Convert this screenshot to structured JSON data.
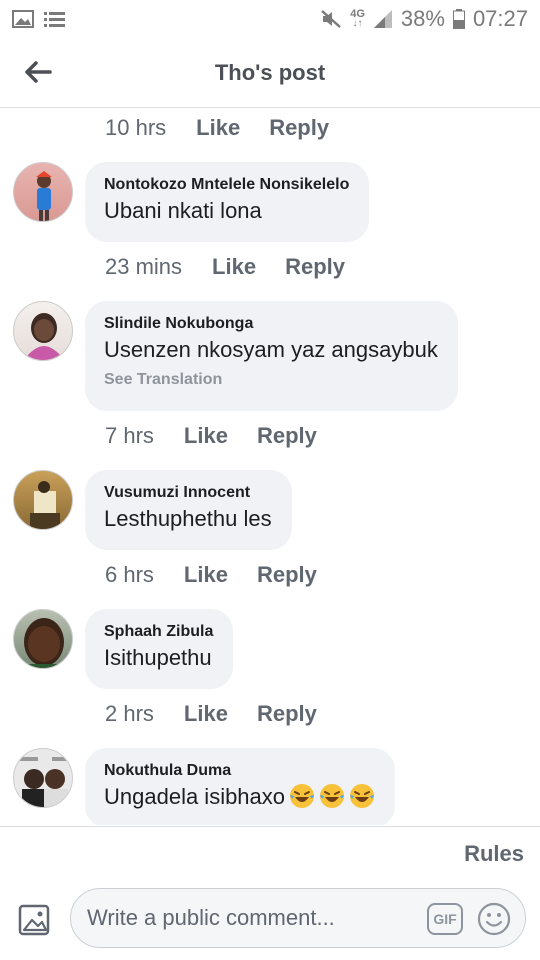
{
  "status_bar": {
    "battery": "38%",
    "time": "07:27",
    "network": "4G"
  },
  "header": {
    "title": "Tho's post"
  },
  "first_meta": {
    "time": "10 hrs",
    "like": "Like",
    "reply": "Reply"
  },
  "comments": [
    {
      "author": "Nontokozo Mntelele Nonsikelelo",
      "text": "Ubani nkati lona",
      "time": "23 mins",
      "like": "Like",
      "reply": "Reply"
    },
    {
      "author": "Slindile Nokubonga",
      "text": "Usenzen nkosyam yaz angsaybuk",
      "see_translation": "See Translation",
      "time": "7 hrs",
      "like": "Like",
      "reply": "Reply"
    },
    {
      "author": "Vusumuzi Innocent",
      "text": "Lesthuphethu les",
      "time": "6 hrs",
      "like": "Like",
      "reply": "Reply"
    },
    {
      "author": "Sphaah Zibula",
      "text": "Isithupethu",
      "time": "2 hrs",
      "like": "Like",
      "reply": "Reply"
    },
    {
      "author": "Nokuthula Duma",
      "text": "Ungadela isibhaxo",
      "emoji": "crying-laughing-face-icon"
    }
  ],
  "footer": {
    "rules": "Rules",
    "placeholder": "Write a public comment...",
    "gif": "GIF"
  },
  "colors": {
    "bubble": "#f0f2f5",
    "meta_text": "#606770",
    "header_text": "#4b4f56"
  }
}
